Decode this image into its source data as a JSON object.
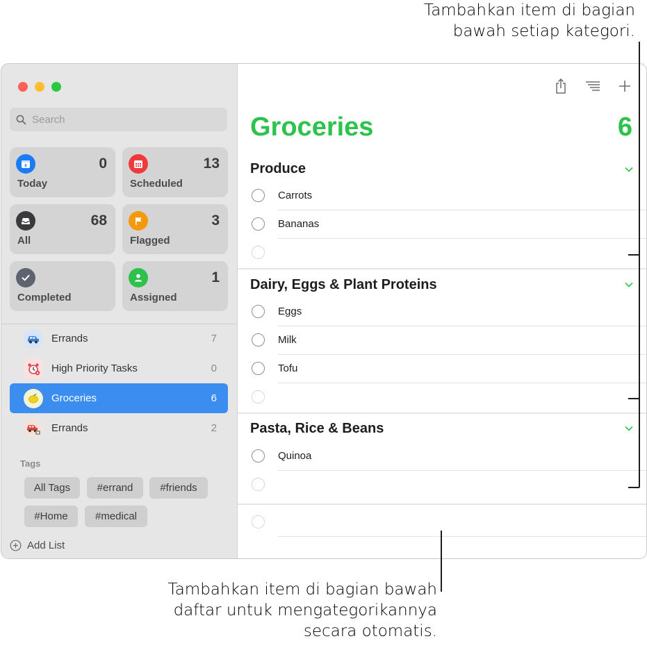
{
  "annotations": {
    "top": [
      "Tambahkan item di bagian",
      "bawah setiap kategori."
    ],
    "bottom": [
      "Tambahkan item di bagian bawah",
      "daftar untuk mengategorikannya",
      "secara otomatis."
    ]
  },
  "window_controls": {
    "close_color": "#fe5f57",
    "minimize_color": "#febc2e",
    "zoom_color": "#28c840"
  },
  "search": {
    "placeholder": "Search"
  },
  "smart_lists": [
    {
      "label": "Today",
      "count": "0",
      "icon": "calendar-icon",
      "color": "#1a7cf5"
    },
    {
      "label": "Scheduled",
      "count": "13",
      "icon": "calendar-grid-icon",
      "color": "#f0393a"
    },
    {
      "label": "All",
      "count": "68",
      "icon": "tray-icon",
      "color": "#3a3a3c"
    },
    {
      "label": "Flagged",
      "count": "3",
      "icon": "flag-icon",
      "color": "#f39a0c"
    },
    {
      "label": "Completed",
      "count": "",
      "icon": "checkmark-icon",
      "color": "#5d6470"
    },
    {
      "label": "Assigned",
      "count": "1",
      "icon": "person-icon",
      "color": "#2ec14c"
    }
  ],
  "my_lists": [
    {
      "name": "Errands",
      "count": "7",
      "icon": "car-icon"
    },
    {
      "name": "High Priority Tasks",
      "count": "0",
      "icon": "alarm-clock-icon"
    },
    {
      "name": "Groceries",
      "count": "6",
      "icon": "lemon-icon",
      "selected": true
    },
    {
      "name": "Errands",
      "count": "2",
      "icon": "red-car-icon"
    }
  ],
  "tags": {
    "heading": "Tags",
    "items": [
      "All Tags",
      "#errand",
      "#friends",
      "#Home",
      "#medical"
    ]
  },
  "add_list_label": "Add List",
  "main": {
    "title": "Groceries",
    "count": "6",
    "accent": "#2cc24b",
    "sections": [
      {
        "title": "Produce",
        "items": [
          "Carrots",
          "Bananas"
        ]
      },
      {
        "title": "Dairy, Eggs & Plant Proteins",
        "items": [
          "Eggs",
          "Milk",
          "Tofu"
        ]
      },
      {
        "title": "Pasta, Rice & Beans",
        "items": [
          "Quinoa"
        ]
      }
    ]
  }
}
